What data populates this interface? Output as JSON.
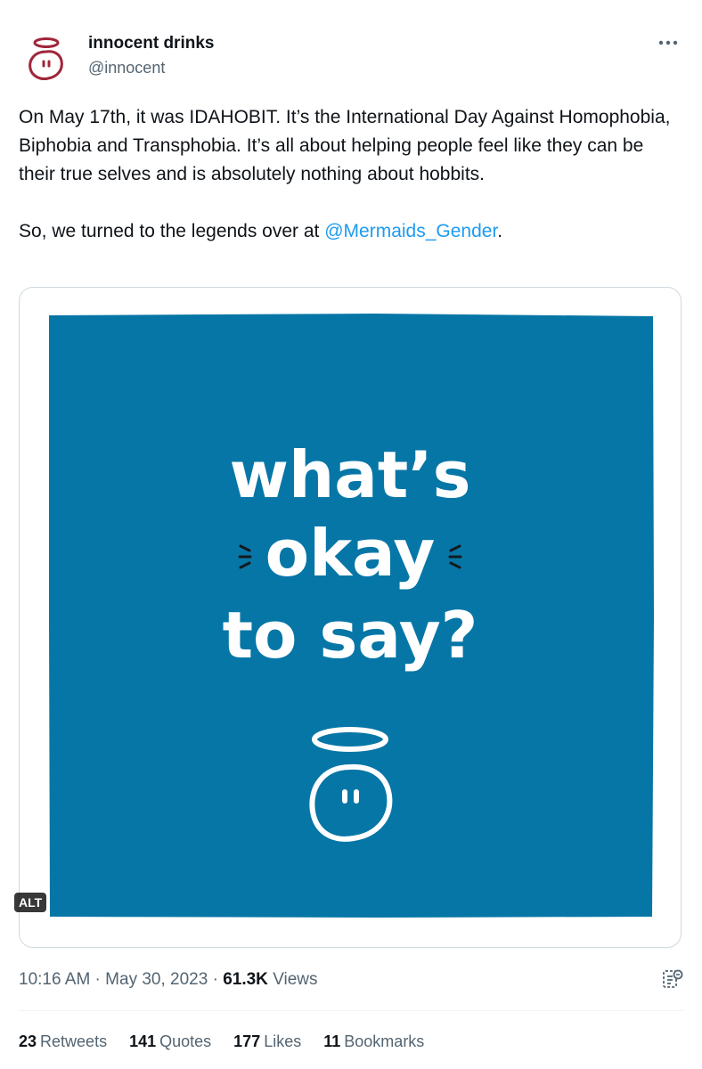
{
  "account": {
    "name": "innocent drinks",
    "handle": "@innocent",
    "avatar_icon": "innocent-logo-icon"
  },
  "tweet": {
    "paragraph1": "On May 17th, it was IDAHOBIT. It’s the International Day Against Homophobia, Biphobia and Transphobia. It’s all about helping people feel like they can be their true selves and is absolutely nothing about hobbits.",
    "paragraph2_prefix": "So, we turned to the legends over at ",
    "mention": "@Mermaids_Gender",
    "paragraph2_suffix": "."
  },
  "media": {
    "line1": "what’s",
    "line2": "okay",
    "line3": "to say?",
    "alt_label": "ALT",
    "background_color": "#0676a6"
  },
  "meta": {
    "time": "10:16 AM",
    "separator": " · ",
    "date": "May 30, 2023",
    "views_count": "61.3K",
    "views_label": "Views"
  },
  "stats": [
    {
      "count": "23",
      "label": "Retweets"
    },
    {
      "count": "141",
      "label": "Quotes"
    },
    {
      "count": "177",
      "label": "Likes"
    },
    {
      "count": "11",
      "label": "Bookmarks"
    }
  ],
  "colors": {
    "brand_logo": "#a0253a",
    "link": "#1d9bf0",
    "secondary_text": "#536471"
  }
}
